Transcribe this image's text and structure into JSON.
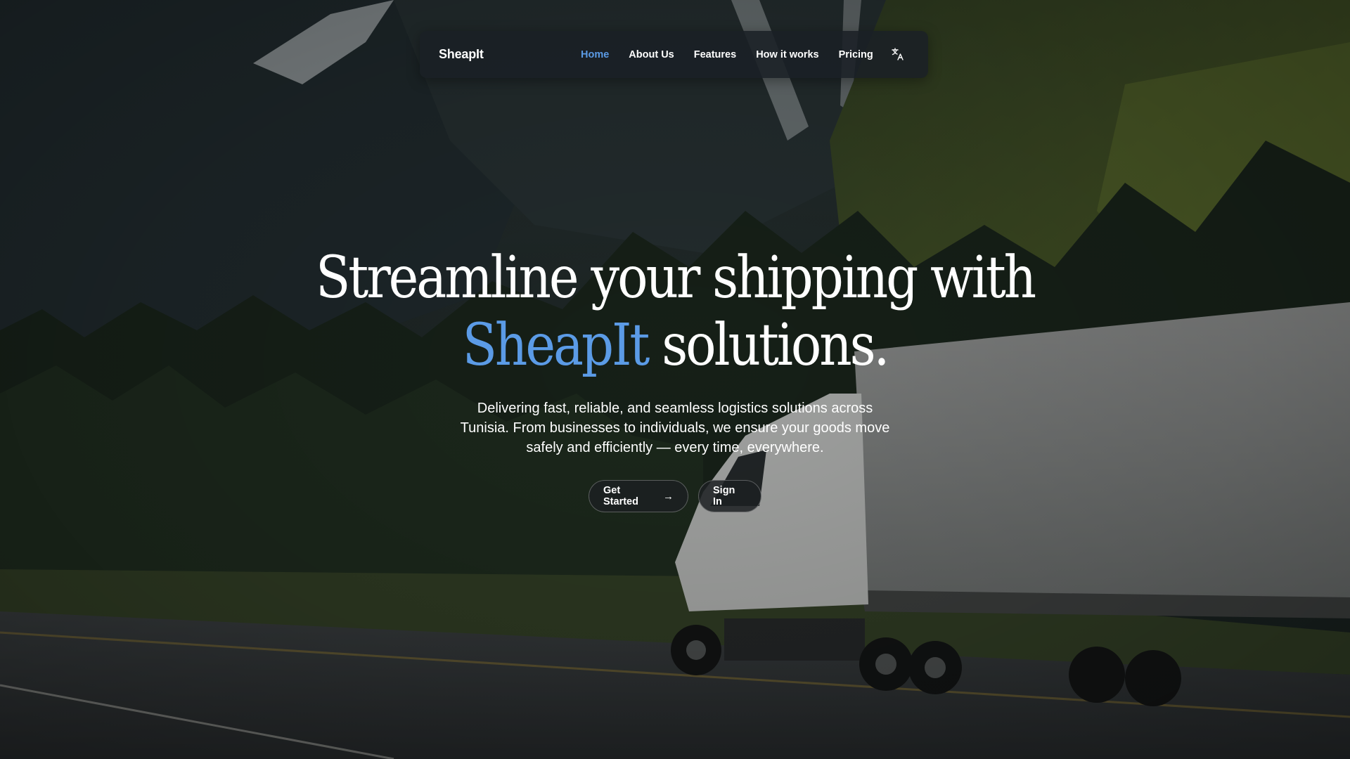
{
  "nav": {
    "brand": "SheapIt",
    "links": [
      {
        "label": "Home",
        "active": true
      },
      {
        "label": "About Us",
        "active": false
      },
      {
        "label": "Features",
        "active": false
      },
      {
        "label": "How it works",
        "active": false
      },
      {
        "label": "Pricing",
        "active": false
      }
    ],
    "language_icon": "translate-icon"
  },
  "hero": {
    "headline_line1": "Streamline your shipping with",
    "headline_accent": "SheapIt",
    "headline_line2_rest": "solutions.",
    "subtext_lines": [
      "Delivering fast, reliable, and seamless logistics solutions across",
      "Tunisia. From businesses to individuals, we ensure your goods move",
      "safely and efficiently — every time, everywhere."
    ],
    "primary_button": "Get Started",
    "primary_button_icon": "arrow-right-icon",
    "secondary_button": "Sign In",
    "background_image": "semi-truck on mountain highway with pine forest"
  },
  "colors": {
    "accent": "#5b9be6",
    "nav_background": "#1a2026",
    "text": "#ffffff"
  }
}
